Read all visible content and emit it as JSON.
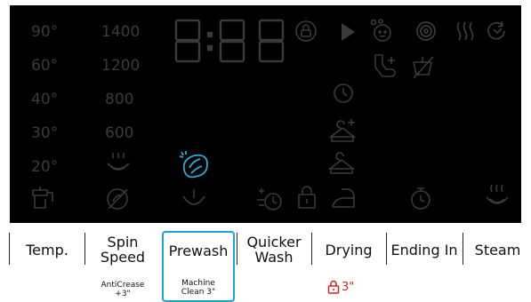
{
  "panel": {
    "temps": [
      "90°",
      "60°",
      "40°",
      "30°",
      "20°"
    ],
    "speeds": [
      "1400",
      "1200",
      "800",
      "600"
    ],
    "display_time": "8:88",
    "colors": {
      "dim": "#3a3a3a",
      "active": "#2ea8d8",
      "tab_border": "#19a3d6",
      "lock_red": "#dd2222"
    }
  },
  "tabs": [
    {
      "label": "Temp."
    },
    {
      "label": "Spin\nSpeed"
    },
    {
      "label": "Prewash"
    },
    {
      "label": "Quicker\nWash"
    },
    {
      "label": "Drying"
    },
    {
      "label": "Ending In"
    },
    {
      "label": "Steam"
    }
  ],
  "subs": {
    "anticrease": "AntiCrease\n+3\"",
    "machine_clean": "Machine\nClean 3\"",
    "lock_time": "3\""
  }
}
